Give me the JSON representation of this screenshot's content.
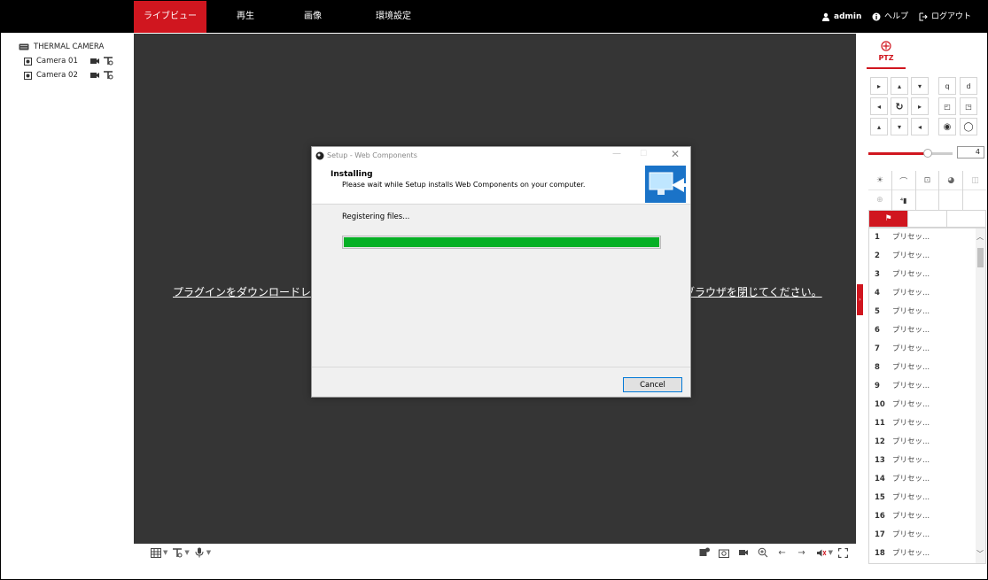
{
  "header": {
    "tabs": [
      {
        "label": "ライブビュー",
        "active": true
      },
      {
        "label": "再生",
        "active": false
      },
      {
        "label": "画像",
        "active": false
      },
      {
        "label": "環境設定",
        "active": false
      }
    ],
    "user": "admin",
    "help": "ヘルプ",
    "logout": "ログアウト",
    "accent": "#d0161f"
  },
  "tree": {
    "root": "THERMAL CAMERA",
    "cameras": [
      "Camera 01",
      "Camera 02"
    ]
  },
  "video": {
    "notice_left": "プラグインをダウンロードレイ",
    "notice_right": "ブラウザを閉じてください。"
  },
  "dialog": {
    "title": "Setup - Web Components",
    "heading": "Installing",
    "subheading": "Please wait while Setup installs Web Components on your computer.",
    "status": "Registering files...",
    "progress_pct": 100,
    "cancel_label": "Cancel",
    "progress_color": "#06b025"
  },
  "ptz": {
    "label": "PTZ",
    "speed": "4",
    "speed_fraction": 0.7,
    "preset_label": "プリセッ...",
    "preset_numbers": [
      "1",
      "2",
      "3",
      "4",
      "5",
      "6",
      "7",
      "8",
      "9",
      "10",
      "11",
      "12",
      "13",
      "14",
      "15",
      "16",
      "17",
      "18"
    ]
  }
}
